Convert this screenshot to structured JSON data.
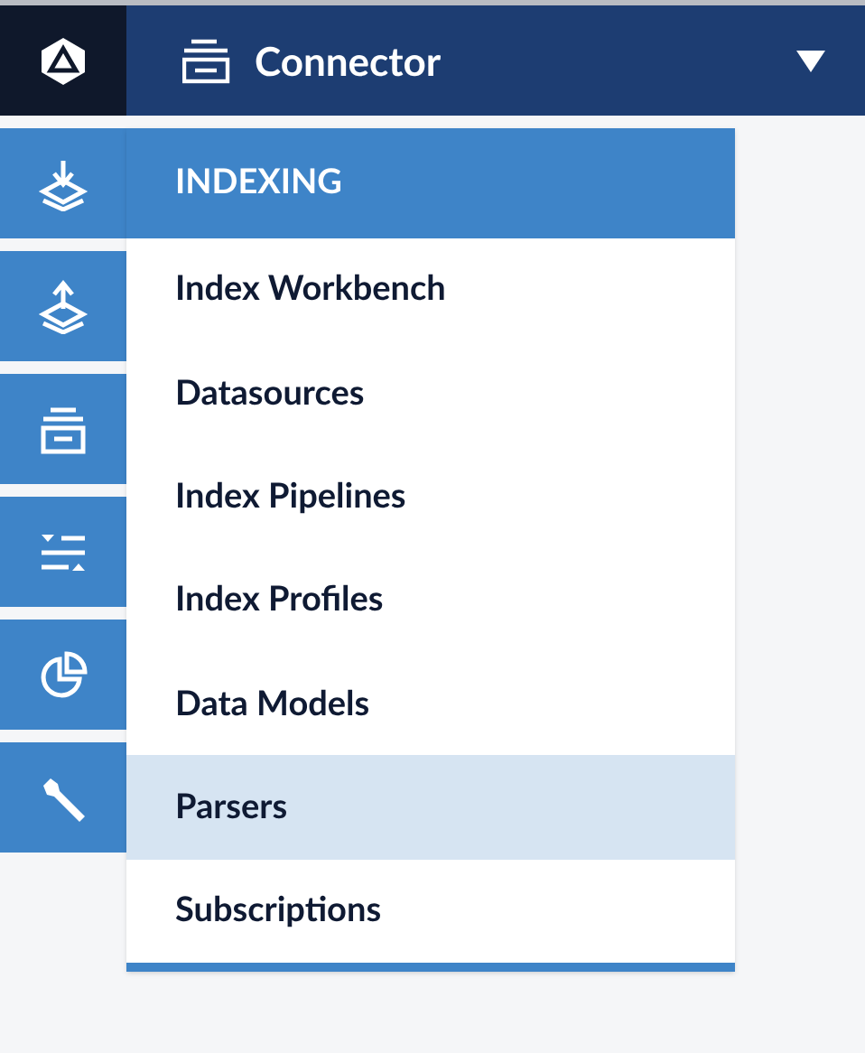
{
  "top_bar": {
    "title": "Connector"
  },
  "sidebar": {
    "items": [
      {
        "kind": "index-down"
      },
      {
        "kind": "index-up"
      },
      {
        "kind": "connector"
      },
      {
        "kind": "sliders"
      },
      {
        "kind": "pie"
      },
      {
        "kind": "wrench"
      }
    ]
  },
  "menu": {
    "heading": "INDEXING",
    "items": [
      {
        "label": "Index Workbench",
        "selected": false
      },
      {
        "label": "Datasources",
        "selected": false
      },
      {
        "label": "Index Pipelines",
        "selected": false
      },
      {
        "label": "Index Profiles",
        "selected": false
      },
      {
        "label": "Data Models",
        "selected": false
      },
      {
        "label": "Parsers",
        "selected": true
      },
      {
        "label": "Subscriptions",
        "selected": false
      }
    ]
  }
}
